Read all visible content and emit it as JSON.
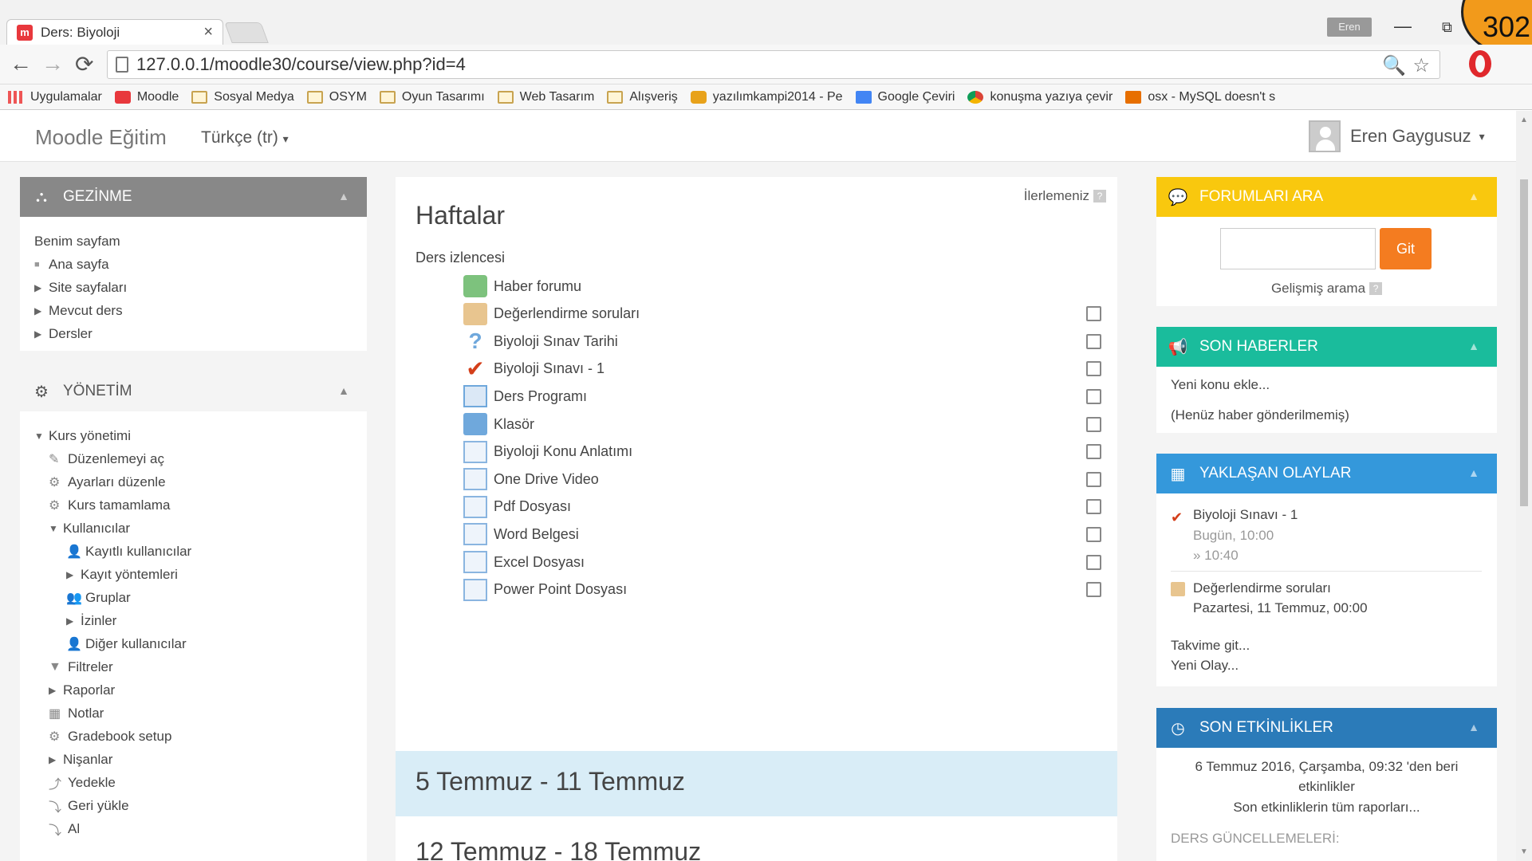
{
  "browser": {
    "tab_title": "Ders: Biyoloji",
    "tab_close": "×",
    "user_badge": "Eren",
    "minimize": "—",
    "restore": "⧉",
    "overlay_number": "302",
    "back": "←",
    "forward": "→",
    "reload": "⟳",
    "zoom_icon": "🔍",
    "star_icon": "☆",
    "url": "127.0.0.1/moodle30/course/view.php?id=4",
    "bookmarks": [
      {
        "label": "Uygulamalar",
        "icon": "apps-icon"
      },
      {
        "label": "Moodle",
        "icon": "moodle-icon"
      },
      {
        "label": "Sosyal Medya",
        "icon": "folder-icon"
      },
      {
        "label": "OSYM",
        "icon": "folder-icon"
      },
      {
        "label": "Oyun Tasarımı",
        "icon": "folder-icon"
      },
      {
        "label": "Web Tasarım",
        "icon": "folder-icon"
      },
      {
        "label": "Alışveriş",
        "icon": "folder-icon"
      },
      {
        "label": "yazılımkampi2014 - Pe",
        "icon": "tiger-icon"
      },
      {
        "label": "Google Çeviri",
        "icon": "google-translate-icon"
      },
      {
        "label": "konuşma yazıya çevir",
        "icon": "chrome-icon"
      },
      {
        "label": "osx - MySQL doesn't s",
        "icon": "java-icon"
      }
    ]
  },
  "navbar": {
    "brand": "Moodle Eğitim",
    "language": "Türkçe (tr)",
    "caret": "▾",
    "user_name": "Eren Gaygusuz"
  },
  "left": {
    "nav": {
      "title": "GEZİNME",
      "collapse": "▲",
      "items": [
        {
          "label": "Benim sayfam",
          "marker": ""
        },
        {
          "label": "Ana sayfa",
          "marker": "■"
        },
        {
          "label": "Site sayfaları",
          "marker": "▶"
        },
        {
          "label": "Mevcut ders",
          "marker": "▶"
        },
        {
          "label": "Dersler",
          "marker": "▶"
        }
      ]
    },
    "admin": {
      "title": "YÖNETİM",
      "collapse": "▲",
      "items": [
        {
          "label": "Kurs yönetimi",
          "marker": "▼",
          "icon": ""
        },
        {
          "label": "Düzenlemeyi aç",
          "marker": "",
          "icon": "✎"
        },
        {
          "label": "Ayarları düzenle",
          "marker": "",
          "icon": "⚙"
        },
        {
          "label": "Kurs tamamlama",
          "marker": "",
          "icon": "⚙"
        },
        {
          "label": "Kullanıcılar",
          "marker": "▼",
          "icon": ""
        },
        {
          "label": "Kayıtlı kullanıcılar",
          "marker": "",
          "icon": "👤"
        },
        {
          "label": "Kayıt yöntemleri",
          "marker": "▶",
          "icon": ""
        },
        {
          "label": "Gruplar",
          "marker": "",
          "icon": "👥"
        },
        {
          "label": "İzinler",
          "marker": "▶",
          "icon": ""
        },
        {
          "label": "Diğer kullanıcılar",
          "marker": "",
          "icon": "👤"
        },
        {
          "label": "Filtreler",
          "marker": "",
          "icon": "▼"
        },
        {
          "label": "Raporlar",
          "marker": "▶",
          "icon": ""
        },
        {
          "label": "Notlar",
          "marker": "",
          "icon": "▦"
        },
        {
          "label": "Gradebook setup",
          "marker": "",
          "icon": "⚙"
        },
        {
          "label": "Nişanlar",
          "marker": "▶",
          "icon": ""
        },
        {
          "label": "Yedekle",
          "marker": "",
          "icon": "⤴"
        },
        {
          "label": "Geri yükle",
          "marker": "",
          "icon": "⤵"
        },
        {
          "label": "Al",
          "marker": "",
          "icon": "⤵"
        }
      ]
    }
  },
  "main": {
    "progress_label": "İlerlemeniz",
    "help": "?",
    "section_title": "Haftalar",
    "summary": "Ders izlencesi",
    "activities": [
      {
        "label": "Haber forumu",
        "type": "forum",
        "checkbox": false
      },
      {
        "label": "Değerlendirme soruları",
        "type": "feedback",
        "checkbox": true
      },
      {
        "label": "Biyoloji Sınav Tarihi",
        "type": "question",
        "checkbox": true
      },
      {
        "label": "Biyoloji Sınavı - 1",
        "type": "quiz",
        "checkbox": true
      },
      {
        "label": "Ders Programı",
        "type": "word",
        "checkbox": true
      },
      {
        "label": "Klasör",
        "type": "folder",
        "checkbox": true
      },
      {
        "label": "Biyoloji Konu Anlatımı",
        "type": "page",
        "checkbox": true
      },
      {
        "label": "One Drive Video",
        "type": "page",
        "checkbox": true
      },
      {
        "label": "Pdf Dosyası",
        "type": "page",
        "checkbox": true
      },
      {
        "label": "Word Belgesi",
        "type": "page",
        "checkbox": true
      },
      {
        "label": "Excel Dosyası",
        "type": "page",
        "checkbox": true
      },
      {
        "label": "Power Point Dosyası",
        "type": "page",
        "checkbox": true
      }
    ],
    "weeks": [
      "5 Temmuz - 11 Temmuz",
      "12 Temmuz - 18 Temmuz"
    ]
  },
  "right": {
    "search": {
      "title": "FORUMLARI ARA",
      "collapse": "▲",
      "go": "Git",
      "advanced": "Gelişmiş arama",
      "help": "?"
    },
    "news": {
      "title": "SON HABERLER",
      "collapse": "▲",
      "add": "Yeni konu ekle...",
      "empty": "(Henüz haber gönderilmemiş)"
    },
    "events": {
      "title": "YAKLAŞAN OLAYLAR",
      "collapse": "▲",
      "e1_name": "Biyoloji Sınavı - 1",
      "e1_date": "Bugün, 10:00",
      "e1_end": "» 10:40",
      "e2_name": "Değerlendirme soruları",
      "e2_date": "Pazartesi, 11 Temmuz, 00:00",
      "goto": "Takvime git...",
      "new": "Yeni Olay..."
    },
    "recent": {
      "title": "SON ETKİNLİKLER",
      "collapse": "▲",
      "since_1": "6 Temmuz 2016, Çarşamba, 09:32 'den beri",
      "since_2": "etkinlikler",
      "full_report": "Son etkinliklerin tüm raporları...",
      "updates": "DERS GÜNCELLEMELERİ:"
    }
  },
  "scroll": {
    "up": "▲",
    "down": "▼"
  }
}
